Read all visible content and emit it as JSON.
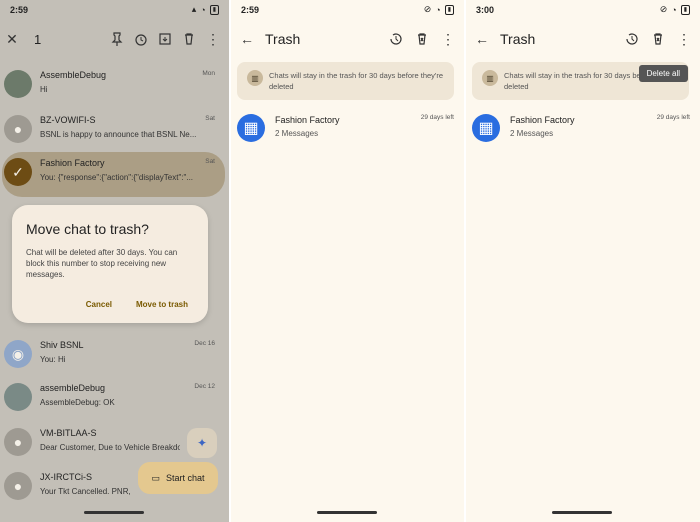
{
  "screen1": {
    "status": {
      "time": "2:59"
    },
    "appbar": {
      "count": "1"
    },
    "rows": [
      {
        "name": "AssembleDebug",
        "snippet": "Hi",
        "date": "Mon"
      },
      {
        "name": "BZ-VOWIFI-S",
        "snippet": "BSNL is happy to announce that BSNL Ne...",
        "date": "Sat"
      },
      {
        "name": "Fashion Factory",
        "snippet": "You: {\"response\":{\"action\":{\"displayText\":\"...",
        "date": "Sat"
      },
      {
        "name": "Shiv BSNL",
        "snippet": "You: Hi",
        "date": "Dec 16"
      },
      {
        "name": "assembleDebug",
        "snippet": "AssembleDebug: OK",
        "date": "Dec 12"
      },
      {
        "name": "VM-BITLAA-S",
        "snippet": "Dear Customer, Due to Vehicle Breakdo...",
        "date": ""
      },
      {
        "name": "JX-IRCTCi-S",
        "snippet": "Your Tkt Cancelled. PNR, ...",
        "date": ""
      }
    ],
    "dialog": {
      "title": "Move chat to trash?",
      "body": "Chat will be deleted after 30 days. You can block this number to stop receiving new messages.",
      "cancel": "Cancel",
      "confirm": "Move to trash"
    },
    "fab_label": "Start chat"
  },
  "screen2": {
    "status": {
      "time": "2:59"
    },
    "title": "Trash",
    "banner": "Chats will stay in the trash for 30 days before they're deleted",
    "conv": {
      "name": "Fashion Factory",
      "count": "2 Messages",
      "date": "29 days left"
    }
  },
  "screen3": {
    "status": {
      "time": "3:00"
    },
    "title": "Trash",
    "banner": "Chats will stay in the trash for 30 days before they're deleted",
    "menu": "Delete all",
    "conv": {
      "name": "Fashion Factory",
      "count": "2 Messages",
      "date": "29 days left"
    }
  },
  "colors": {
    "accent_blue": "#2a6de0",
    "dialog_action": "#7a5a00",
    "fab": "#e4c88f"
  }
}
